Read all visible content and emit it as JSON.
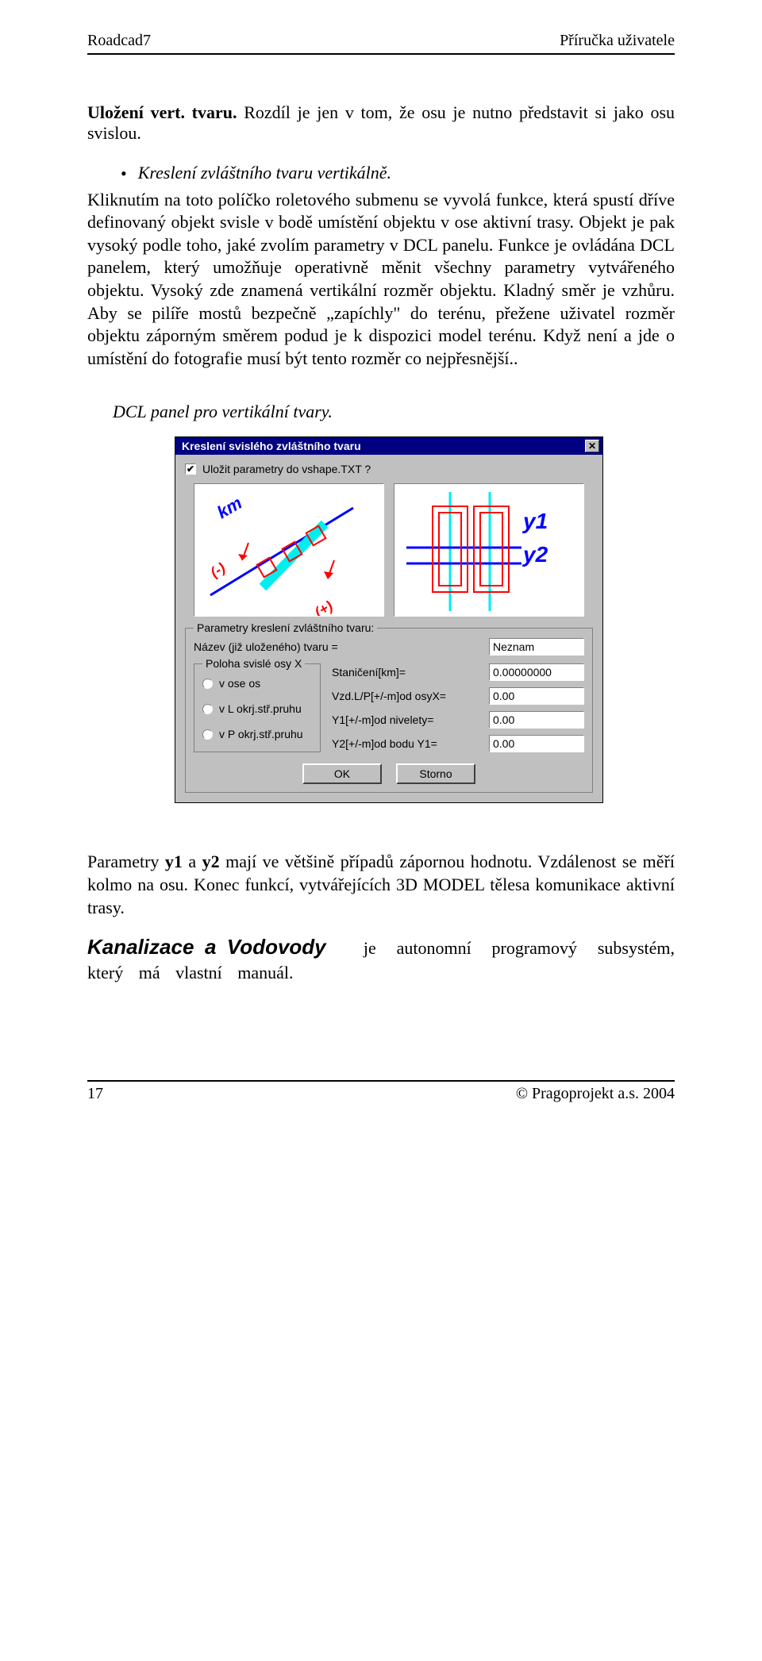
{
  "header": {
    "left": "Roadcad7",
    "right": "Příručka uživatele"
  },
  "title_bold": "Uložení vert. tvaru.",
  "title_rest": "  Rozdíl je jen v tom, že osu je nutno představit si jako osu svislou.",
  "bullet_label": "Kreslení zvláštního tvaru vertikálně.",
  "para1": "Kliknutím na toto políčko roletového submenu se vyvolá funkce, která spustí dříve definovaný objekt svisle v bodě umístění objektu v ose aktivní trasy. Objekt je pak vysoký podle toho, jaké zvolím parametry v DCL panelu. Funkce je ovládána DCL panelem, který umožňuje operativně měnit všechny parametry vytvářeného objektu. Vysoký zde znamená vertikální rozměr objektu. Kladný směr je vzhůru. Aby se pilíře mostů bezpečně „zapíchly\" do terénu, přežene uživatel rozměr objektu záporným směrem podud je k dispozici model terénu. Když není a jde o umístění do fotografie musí být tento rozměr co nejpřesnější..",
  "caption": "DCL panel pro vertikální tvary.",
  "dialog": {
    "title": "Kreslení svislého zvláštního tvaru",
    "checkbox": "Uložit parametry  do vshape.TXT ?",
    "fieldset_label": "Parametry  kreslení zvláštního tvaru:",
    "nazev_label": "Název (již uloženého)  tvaru =",
    "nazev_value": "Neznam",
    "poloha_label": "Poloha svislé osy X",
    "radios": [
      "v ose os",
      "v L okrj.stř.pruhu",
      "v P okrj.stř.pruhu"
    ],
    "rows": [
      {
        "label": "Staničení[km]=",
        "value": "0.00000000"
      },
      {
        "label": "Vzd.L/P[+/-m]od osyX=",
        "value": "0.00"
      },
      {
        "label": "Y1[+/-m]od nivelety=",
        "value": "0.00"
      },
      {
        "label": "Y2[+/-m]od bodu Y1=",
        "value": "0.00"
      }
    ],
    "buttons": {
      "ok": "OK",
      "cancel": "Storno"
    },
    "illus_text": {
      "km": "km",
      "minus": "(-)",
      "plus": "(+)",
      "y1": "y1",
      "y2": "y2"
    }
  },
  "para2_before_ital1": "Parametry ",
  "para2_b1": "y1",
  "para2_mid1": " a ",
  "para2_b2": "y2",
  "para2_mid2": " mají ve většině případů ",
  "para2_ital1": "zápornou",
  "para2_mid3": " hodnotu. V",
  "para2_ital2": "zdálenost",
  "para2_end": "  se měří kolmo na osu. Konec funkcí, vytvářejících 3D MODEL tělesa komunikace aktivní trasy.",
  "subsec_head": "Kanalizace a Vodovody",
  "subsec_rest": "je autonomní programový subsystém, který má vlastní manuál.",
  "footer": {
    "left": "17",
    "right": "© Pragoprojekt a.s. 2004"
  }
}
